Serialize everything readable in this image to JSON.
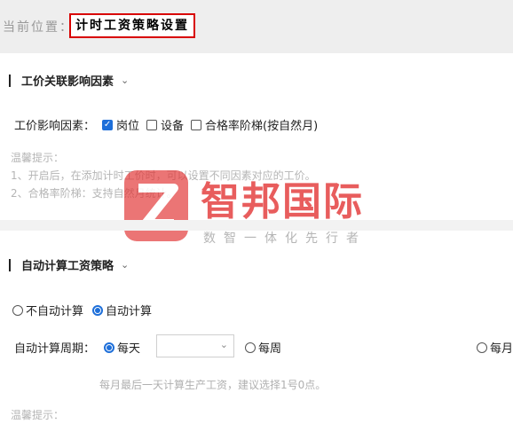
{
  "breadcrumb": {
    "label": "当前位置：",
    "current": "计时工资策略设置"
  },
  "section1": {
    "title": "工价关联影响因素",
    "factors_label": "工价影响因素：",
    "factors": [
      {
        "label": "岗位",
        "checked": true
      },
      {
        "label": "设备",
        "checked": false
      },
      {
        "label": "合格率阶梯(按自然月)",
        "checked": false
      }
    ],
    "tips_title": "温馨提示：",
    "tips": [
      "1、开启后，在添加计时工价时，可以设置不同因素对应的工价。",
      "2、合格率阶梯：支持自然月统计。"
    ]
  },
  "section2": {
    "title": "自动计算工资策略",
    "modes": [
      {
        "label": "不自动计算",
        "checked": false
      },
      {
        "label": "自动计算",
        "checked": true
      }
    ],
    "period_label": "自动计算周期：",
    "periods": [
      {
        "label": "每天",
        "checked": true
      },
      {
        "label": "每周",
        "checked": false
      },
      {
        "label": "每月",
        "checked": false
      }
    ],
    "select_value": "",
    "hint": "每月最后一天计算生产工资，建议选择1号0点。",
    "tips_title": "温馨提示："
  },
  "watermark": {
    "name": "智邦国际",
    "slogan": "数智一体化先行者"
  },
  "colors": {
    "accent": "#1e6fd9",
    "highlight_border": "#d80000",
    "watermark": "#e23434"
  }
}
